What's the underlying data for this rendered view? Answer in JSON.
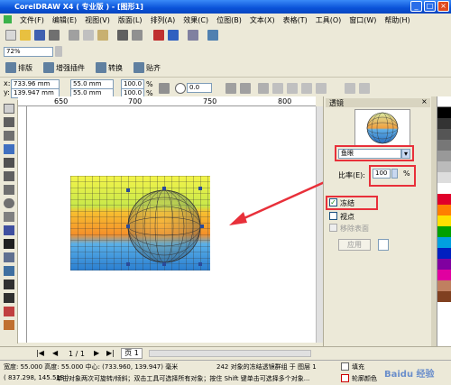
{
  "window": {
    "title": "CorelDRAW X4 ( 专业版 ) - [图形1]"
  },
  "menu": [
    "文件(F)",
    "编辑(E)",
    "视图(V)",
    "版面(L)",
    "排列(A)",
    "效果(C)",
    "位图(B)",
    "文本(X)",
    "表格(T)",
    "工具(O)",
    "窗口(W)",
    "帮助(H)"
  ],
  "toolbar2": {
    "zoom": "72%"
  },
  "toolbar3": {
    "items": [
      "排版",
      "增强插件",
      "转换",
      "贴齐"
    ]
  },
  "property_bar": {
    "x": "733.96 mm",
    "y": "139.947 mm",
    "width": "55.0 mm",
    "height": "55.0 mm",
    "scale_w": "100.0",
    "scale_h": "100.0",
    "pct": "%",
    "rotation": "0.0"
  },
  "ruler": {
    "top_labels": [
      "650",
      "700",
      "750",
      "800"
    ],
    "left_labels": [
      "250",
      "200",
      "150",
      "100"
    ]
  },
  "docker": {
    "title": "透镜",
    "lens_type": "鱼眼",
    "rate_label": "比率(E):",
    "rate_value": "100",
    "rate_unit": "%",
    "freeze_label": "冻结",
    "viewpoint_label": "视点",
    "remove_face_label": "移除表面",
    "apply_label": "应用",
    "side_tabs": [
      "透镜",
      "对象管理器"
    ]
  },
  "page_nav": {
    "counter": "1 / 1",
    "tab": "页 1"
  },
  "status": {
    "line1_left": "宽度: 55.000  高度: 55.000  中心: (733.960, 139.947)  毫米",
    "line1_right": "242 对象的冻结透镜群组 于 图层 1",
    "line2_left": "( 837.298, 145.518 )",
    "line2_middle": "单击对象两次可旋转/倾斜；双击工具可选择所有对象；按住 Shift 键单击可选择多个对象...",
    "fill_label": "填充",
    "outline_label": "轮廓颜色"
  },
  "watermark": "Baidu 经验",
  "colors": {
    "accent_red": "#e8303a",
    "titlebar": "#0a52d8"
  }
}
